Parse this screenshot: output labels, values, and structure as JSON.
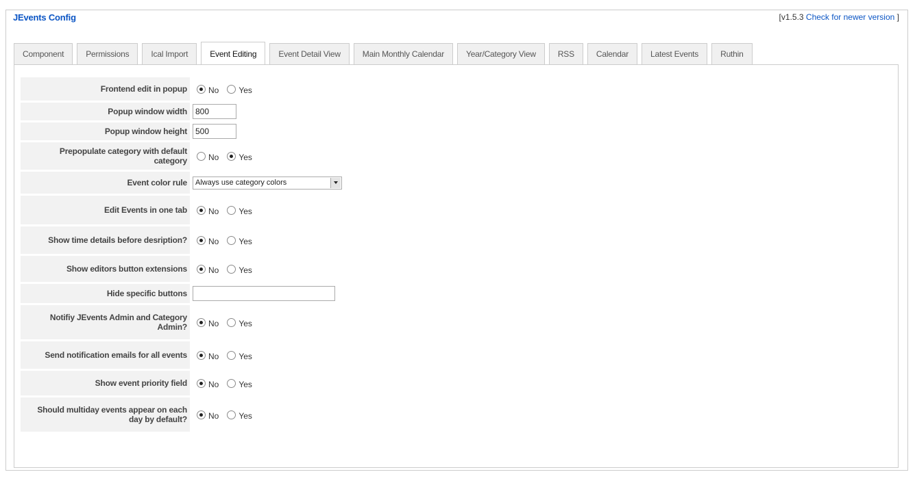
{
  "config": {
    "legend": "JEvents Config",
    "version_prefix": "[v1.5.3",
    "version_link": "Check for newer version",
    "version_suffix": "]"
  },
  "tabs": [
    {
      "label": "Component",
      "active": false
    },
    {
      "label": "Permissions",
      "active": false
    },
    {
      "label": "Ical Import",
      "active": false
    },
    {
      "label": "Event Editing",
      "active": true
    },
    {
      "label": "Event Detail View",
      "active": false
    },
    {
      "label": "Main Monthly Calendar",
      "active": false
    },
    {
      "label": "Year/Category View",
      "active": false
    },
    {
      "label": "RSS",
      "active": false
    },
    {
      "label": "Calendar",
      "active": false
    },
    {
      "label": "Latest Events",
      "active": false
    },
    {
      "label": "Ruthin",
      "active": false
    }
  ],
  "radio_labels": {
    "no": "No",
    "yes": "Yes"
  },
  "fields": {
    "frontend_popup": {
      "label": "Frontend edit in popup",
      "selected": "No"
    },
    "popup_width": {
      "label": "Popup window width",
      "value": "800"
    },
    "popup_height": {
      "label": "Popup window height",
      "value": "500"
    },
    "prepopulate_category": {
      "label": "Prepopulate category with default category",
      "selected": "Yes"
    },
    "event_color_rule": {
      "label": "Event color rule",
      "value": "Always use category colors"
    },
    "edit_one_tab": {
      "label": "Edit Events in one tab",
      "selected": "No"
    },
    "time_before_desc": {
      "label": "Show time details before desription?",
      "selected": "No"
    },
    "editors_button_ext": {
      "label": "Show editors button extensions",
      "selected": "No"
    },
    "hide_buttons": {
      "label": "Hide specific buttons",
      "value": ""
    },
    "notify_admin": {
      "label": "Notifiy JEvents Admin and Category Admin?",
      "selected": "No"
    },
    "notify_all": {
      "label": "Send notification emails for all events",
      "selected": "No"
    },
    "priority_field": {
      "label": "Show event priority field",
      "selected": "No"
    },
    "multiday_each_day": {
      "label": "Should multiday events appear on each day by default?",
      "selected": "No"
    }
  }
}
